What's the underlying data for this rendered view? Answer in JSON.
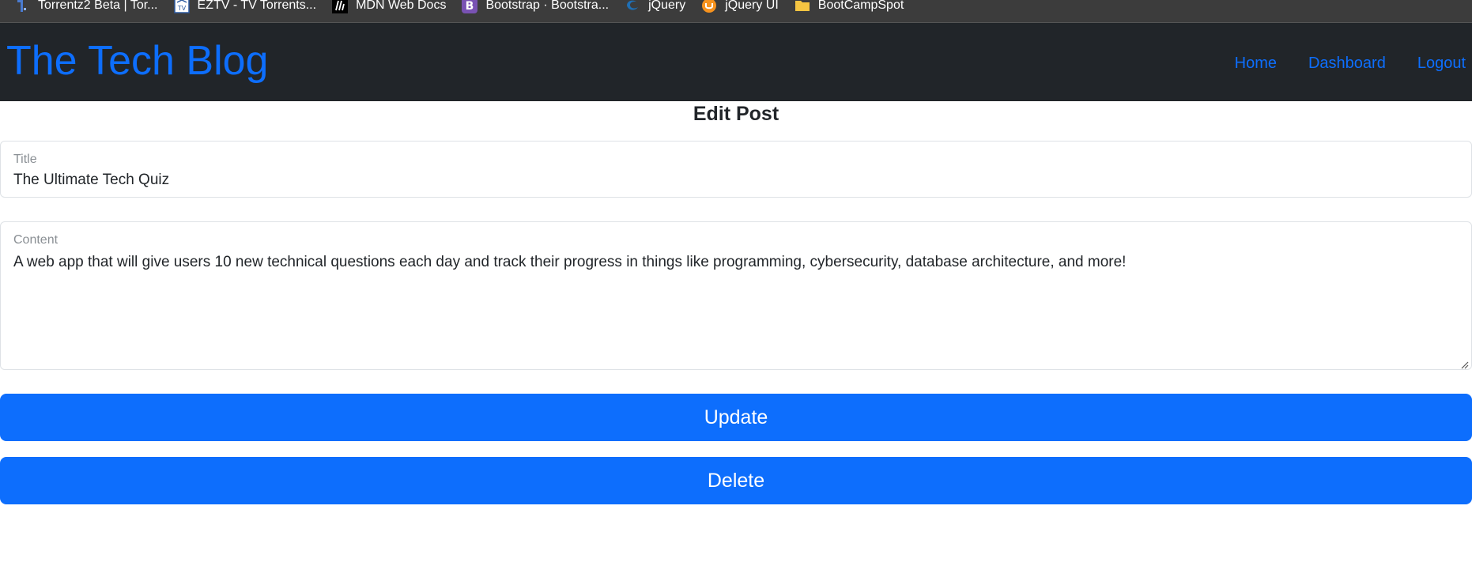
{
  "bookmarks": [
    {
      "label": "Torrentz2 Beta | Tor...",
      "icon": "torrentz-icon"
    },
    {
      "label": "EZTV - TV Torrents...",
      "icon": "eztv-icon"
    },
    {
      "label": "MDN Web Docs",
      "icon": "mdn-icon"
    },
    {
      "label": "Bootstrap · Bootstra...",
      "icon": "bootstrap-icon"
    },
    {
      "label": "jQuery",
      "icon": "jquery-icon"
    },
    {
      "label": "jQuery UI",
      "icon": "jquery-ui-icon"
    },
    {
      "label": "BootCampSpot",
      "icon": "folder-icon"
    }
  ],
  "navbar": {
    "brand": "The Tech Blog",
    "links": {
      "home": "Home",
      "dashboard": "Dashboard",
      "logout": "Logout"
    }
  },
  "form": {
    "heading": "Edit Post",
    "title_label": "Title",
    "title_value": "The Ultimate Tech Quiz",
    "content_label": "Content",
    "content_value": "A web app that will give users 10 new technical questions each day and track their progress in things like programming, cybersecurity, database architecture, and more!",
    "update_label": "Update",
    "delete_label": "Delete"
  },
  "colors": {
    "accent": "#0d6efd",
    "navbar_bg": "#212529",
    "bookmarks_bg": "#3c3c3c"
  }
}
